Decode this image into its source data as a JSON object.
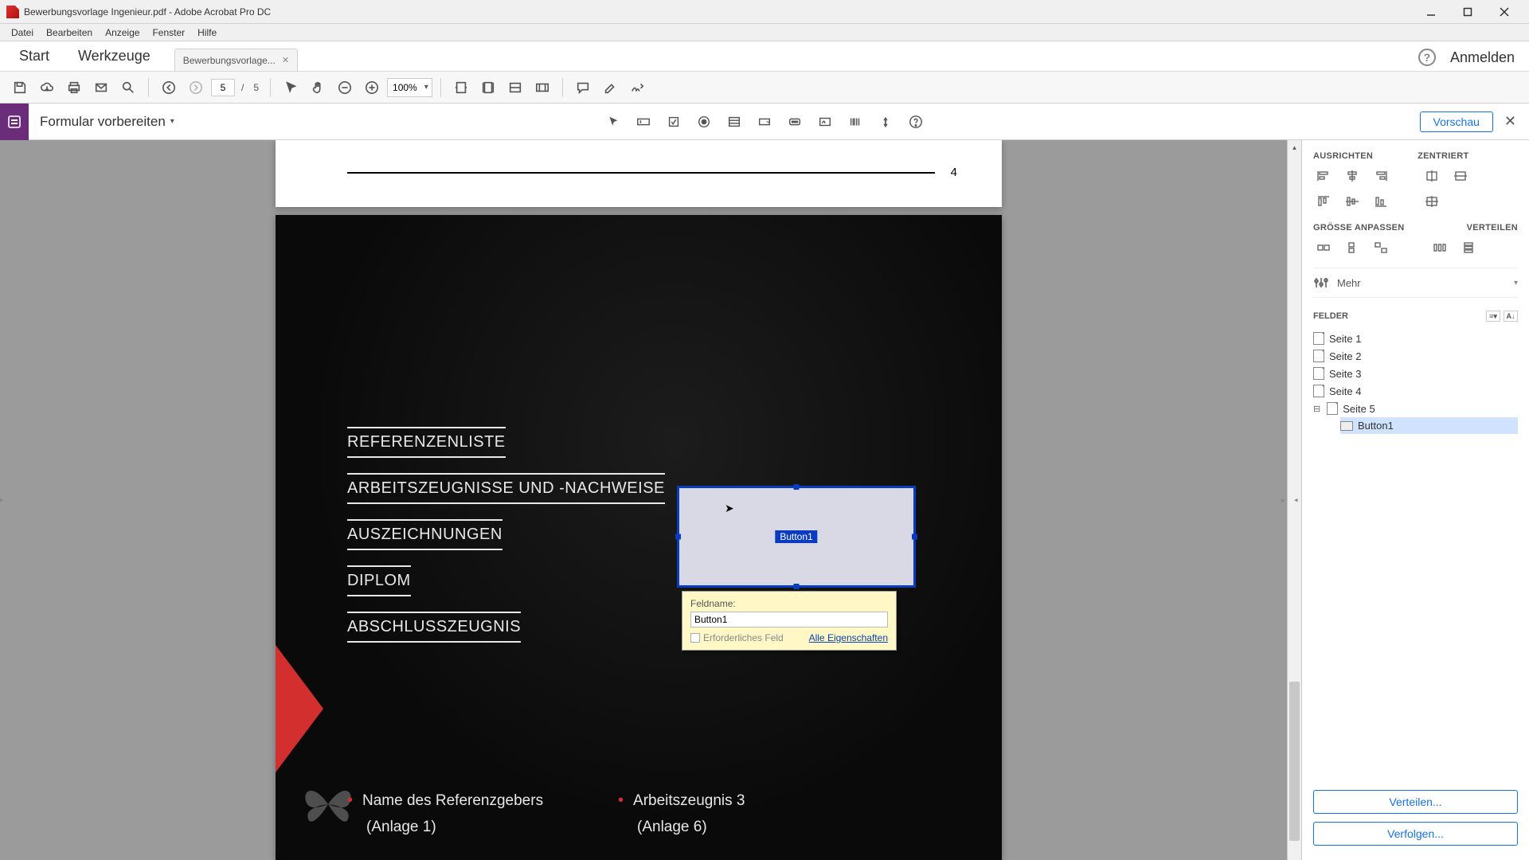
{
  "window": {
    "title": "Bewerbungsvorlage Ingenieur.pdf - Adobe Acrobat Pro DC"
  },
  "menubar": [
    "Datei",
    "Bearbeiten",
    "Anzeige",
    "Fenster",
    "Hilfe"
  ],
  "tabs": {
    "start": "Start",
    "werkzeuge": "Werkzeuge",
    "doc": "Bewerbungsvorlage...",
    "anmelden": "Anmelden"
  },
  "toolbar": {
    "page_current": "5",
    "page_sep": "/",
    "page_total": "5",
    "zoom": "100%"
  },
  "ctxbar": {
    "title": "Formular vorbereiten",
    "vorschau": "Vorschau"
  },
  "page_top": {
    "number": "4"
  },
  "doc": {
    "sections": [
      "REFERENZENLISTE",
      "ARBEITSZEUGNISSE UND -NACHWEISE",
      "AUSZEICHNUNGEN",
      "DIPLOM",
      "ABSCHLUSSZEUGNIS"
    ],
    "col1": {
      "line1": "Name des Referenzgebers",
      "line2": "(Anlage 1)"
    },
    "col2": {
      "line1": "Arbeitszeugnis 3",
      "line2": "(Anlage 6)"
    }
  },
  "formfield": {
    "label": "Button1"
  },
  "popup": {
    "feldname_label": "Feldname:",
    "feldname_value": "Button1",
    "required": "Erforderliches Feld",
    "all_props": "Alle Eigenschaften"
  },
  "rpanel": {
    "h_ausrichten": "AUSRICHTEN",
    "h_zentriert": "ZENTRIERT",
    "h_groesse": "GRÖSSE ANPASSEN",
    "h_verteilen": "VERTEILEN",
    "mehr": "Mehr",
    "felder": "FELDER",
    "pages": [
      "Seite 1",
      "Seite 2",
      "Seite 3",
      "Seite 4",
      "Seite 5"
    ],
    "field_name": "Button1",
    "verteilen_btn": "Verteilen...",
    "verfolgen_btn": "Verfolgen..."
  }
}
